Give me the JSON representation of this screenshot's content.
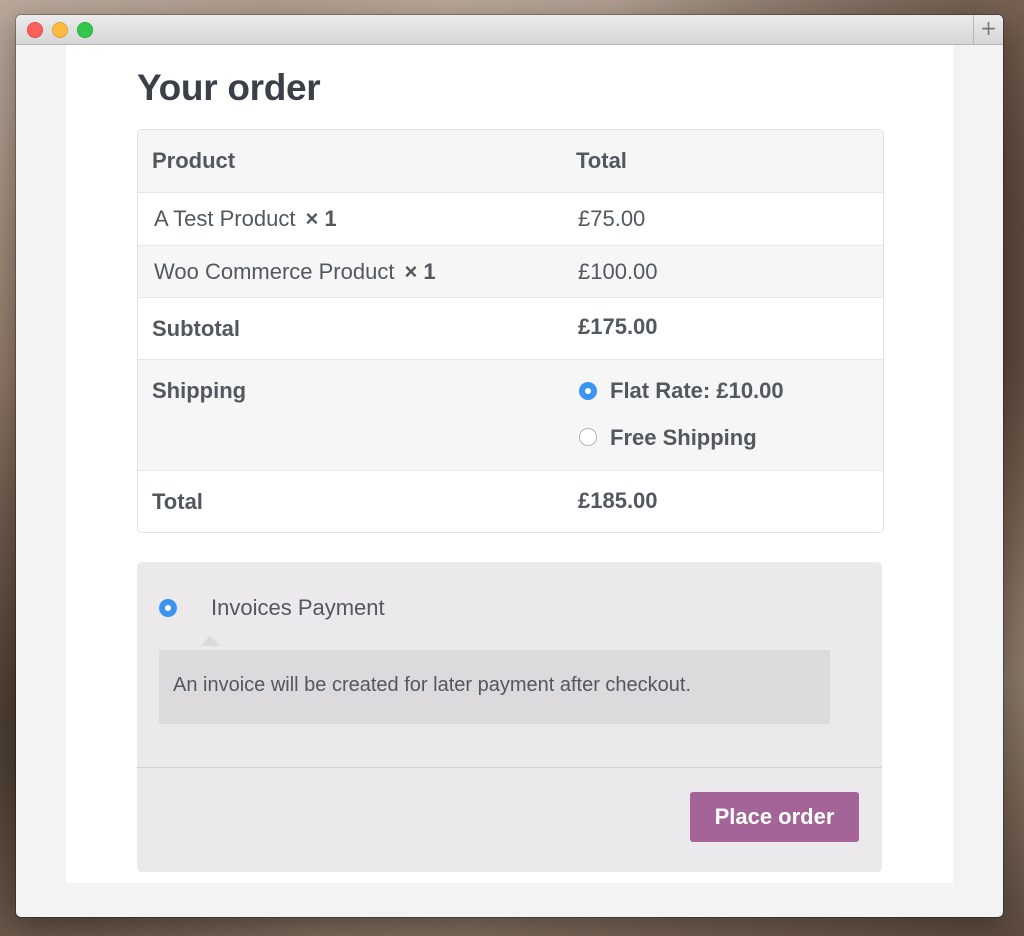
{
  "page": {
    "title": "Your order"
  },
  "order_table": {
    "headers": {
      "product": "Product",
      "total": "Total"
    },
    "items": [
      {
        "name": "A Test Product",
        "qty": "× 1",
        "total": "£75.00"
      },
      {
        "name": "Woo Commerce Product",
        "qty": "× 1",
        "total": "£100.00"
      }
    ],
    "subtotal": {
      "label": "Subtotal",
      "value": "£175.00"
    },
    "shipping": {
      "label": "Shipping",
      "options": [
        {
          "label": "Flat Rate: £10.00",
          "selected": true
        },
        {
          "label": "Free Shipping",
          "selected": false
        }
      ]
    },
    "total": {
      "label": "Total",
      "value": "£185.00"
    }
  },
  "payment": {
    "method_label": "Invoices Payment",
    "method_selected": true,
    "description": "An invoice will be created for later payment after checkout.",
    "place_order_label": "Place order"
  },
  "colors": {
    "accent": "#a46497",
    "radio": "#3b95f0"
  }
}
